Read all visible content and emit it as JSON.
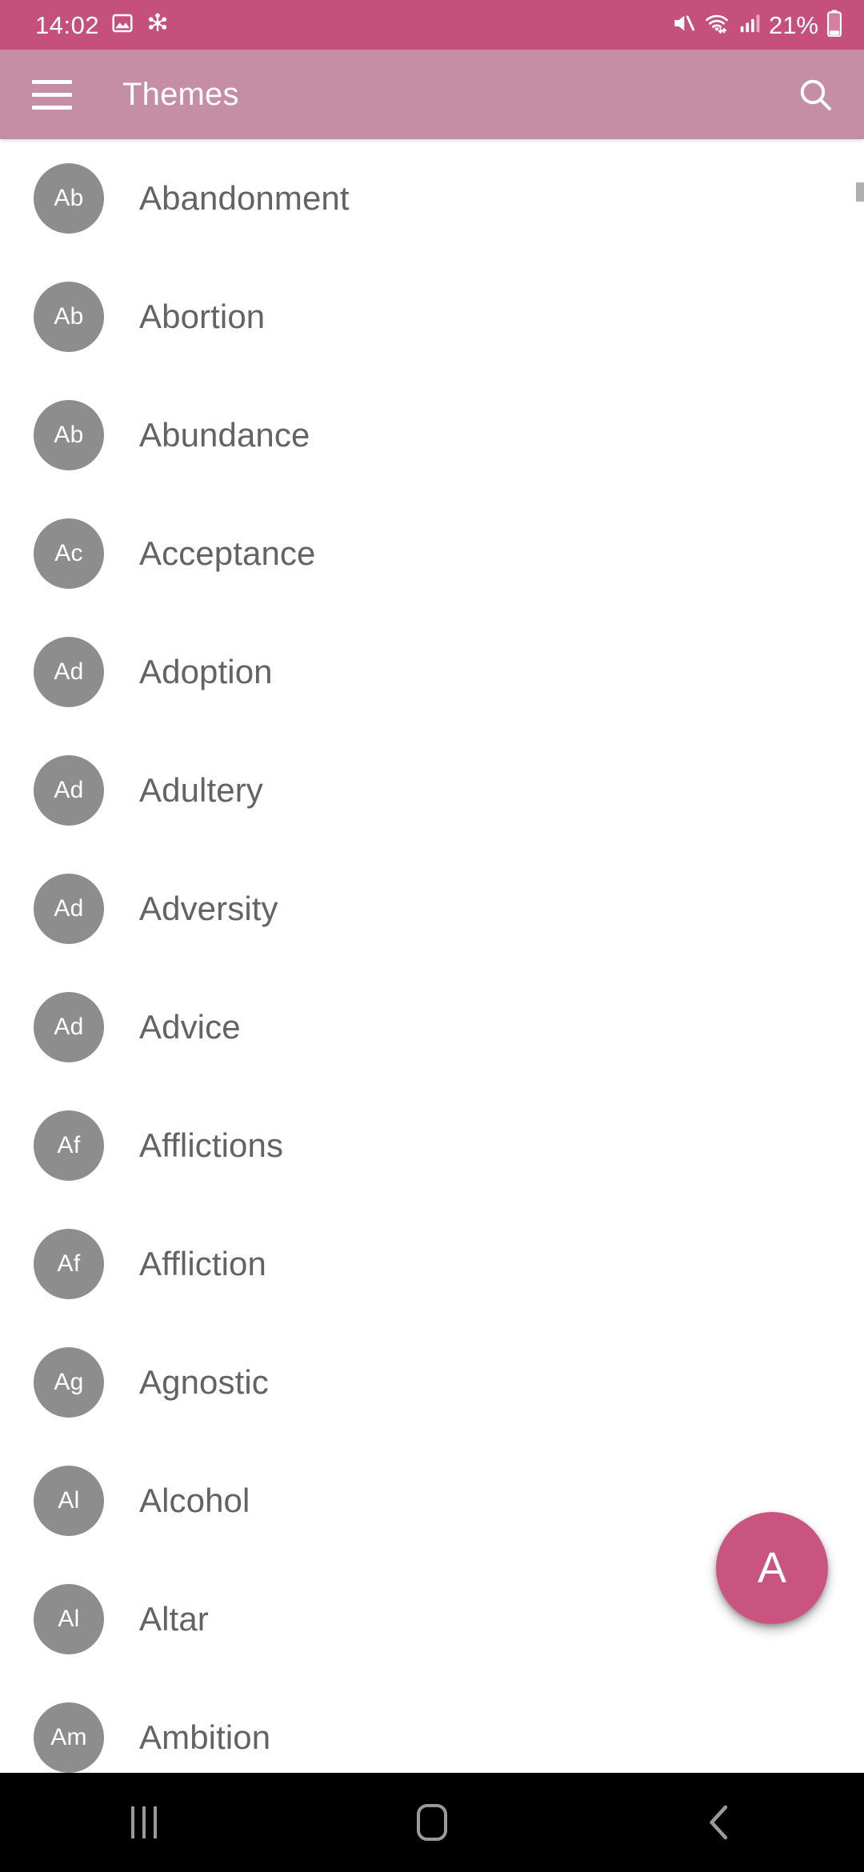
{
  "status_bar": {
    "clock": "14:02",
    "battery_percent": "21%",
    "left_icons": [
      "image-icon",
      "snowflake-icon"
    ],
    "right_icons": [
      "mute-icon",
      "wifi-icon",
      "signal-icon",
      "battery-icon"
    ],
    "background_color": "#c6507c",
    "foreground_color": "#ffffff"
  },
  "app_bar": {
    "title": "Themes",
    "menu_icon": "hamburger-menu-icon",
    "search_icon": "search-icon",
    "background_color": "#c58ea5",
    "foreground_color": "#ffffff"
  },
  "list": {
    "avatar_color": "#8d8d8d",
    "label_color": "#636363",
    "items": [
      {
        "initials": "Ab",
        "label": "Abandonment"
      },
      {
        "initials": "Ab",
        "label": "Abortion"
      },
      {
        "initials": "Ab",
        "label": "Abundance"
      },
      {
        "initials": "Ac",
        "label": "Acceptance"
      },
      {
        "initials": "Ad",
        "label": "Adoption"
      },
      {
        "initials": "Ad",
        "label": "Adultery"
      },
      {
        "initials": "Ad",
        "label": "Adversity"
      },
      {
        "initials": "Ad",
        "label": "Advice"
      },
      {
        "initials": "Af",
        "label": "Afflictions"
      },
      {
        "initials": "Af",
        "label": "Affliction"
      },
      {
        "initials": "Ag",
        "label": "Agnostic"
      },
      {
        "initials": "Al",
        "label": "Alcohol"
      },
      {
        "initials": "Al",
        "label": "Altar"
      },
      {
        "initials": "Am",
        "label": "Ambition"
      }
    ]
  },
  "fab": {
    "label": "A",
    "background_color": "#ca5480",
    "foreground_color": "#ffffff"
  },
  "nav_bar": {
    "recents_icon": "recents-icon",
    "home_icon": "home-icon",
    "back_icon": "back-icon",
    "background_color": "#000000",
    "icon_color": "#9a9a9a"
  }
}
